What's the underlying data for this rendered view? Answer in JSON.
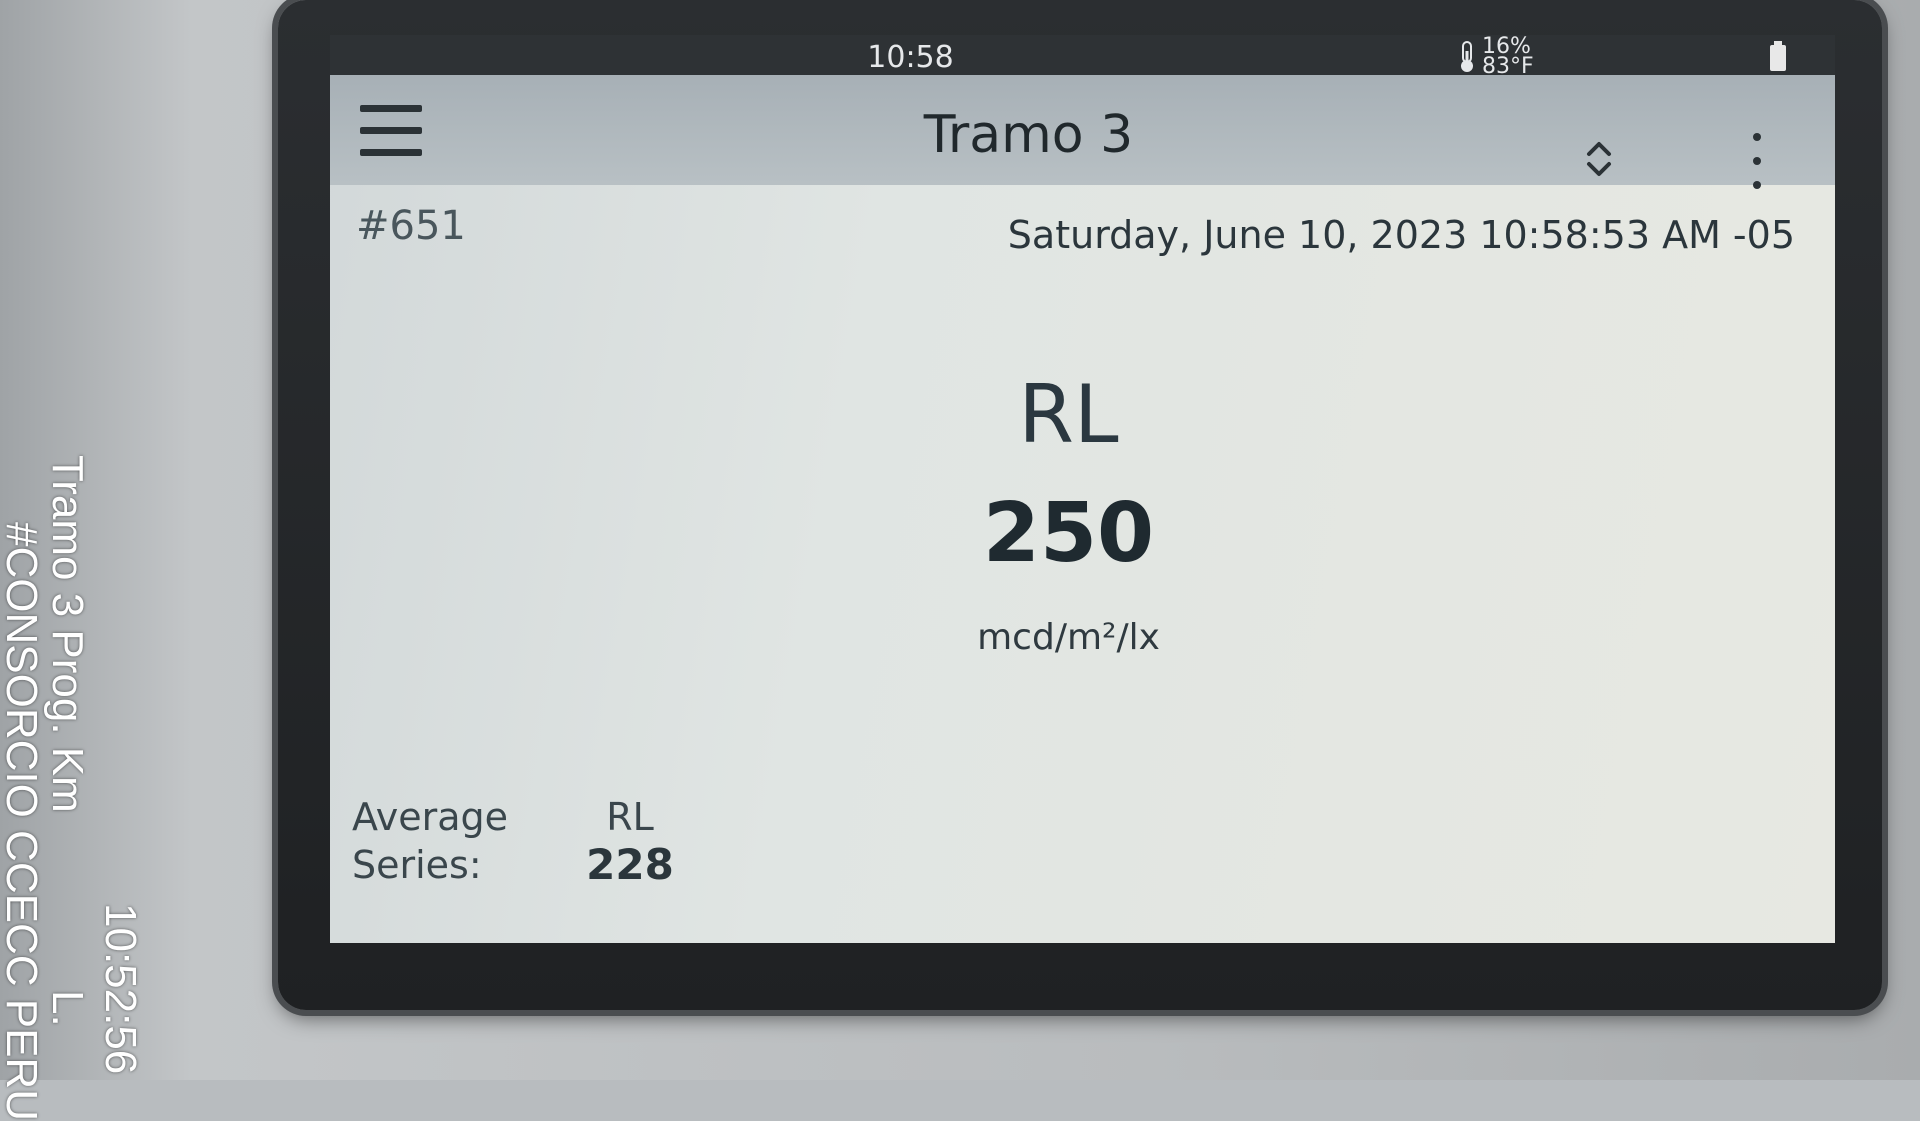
{
  "statusbar": {
    "time": "10:58",
    "humidity": "16%",
    "temperature": "83°F",
    "thermometer_icon": "thermometer-icon",
    "battery_icon": "battery-icon"
  },
  "header": {
    "menu_icon": "hamburger-icon",
    "title": "Tramo 3",
    "sort_icon": "sort-updown-icon",
    "more_icon": "kebab-menu-icon"
  },
  "record": {
    "id": "#651",
    "datetime": "Saturday, June 10, 2023 10:58:53 AM -05"
  },
  "measurement": {
    "label": "RL",
    "value": "250",
    "unit": "mcd/m²/lx"
  },
  "average": {
    "label_line1": "Average",
    "label_line2": "Series:",
    "metric": "RL",
    "value": "228"
  },
  "watermark": {
    "line1": "Tramo 3 Prog. Km",
    "line1_suffix": "L.",
    "line2": "#CONSORCIO CCECC PERU",
    "time": "10:52:56"
  },
  "colors": {
    "bezel": "#1f2123",
    "screen": "#e0e5e3",
    "header": "#b8c0c4",
    "statusbar": "#2e3235"
  }
}
